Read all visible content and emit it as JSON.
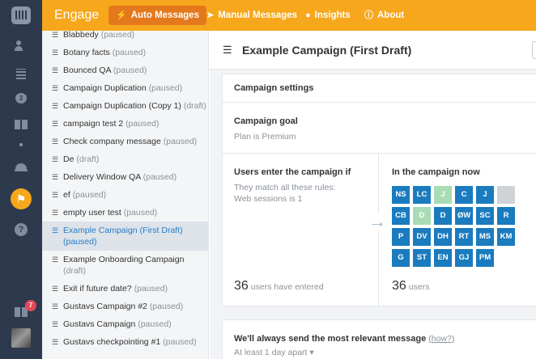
{
  "app": {
    "name": "Engage"
  },
  "nav": [
    {
      "label": "Auto Messages",
      "icon": "lightning-icon",
      "active": true
    },
    {
      "label": "Manual Messages",
      "icon": "paper-plane-icon",
      "active": false
    },
    {
      "label": "Insights",
      "icon": "lightbulb-icon",
      "active": false
    },
    {
      "label": "About",
      "icon": "info-icon",
      "active": false
    }
  ],
  "rail": {
    "notification_badge": "7",
    "chat_count": "3"
  },
  "campaigns": [
    {
      "name": "Blabbedy",
      "status": "(paused)"
    },
    {
      "name": "Botany facts",
      "status": "(paused)"
    },
    {
      "name": "Bounced QA",
      "status": "(paused)"
    },
    {
      "name": "Campaign Duplication",
      "status": "(paused)"
    },
    {
      "name": "Campaign Duplication (Copy 1)",
      "status": "(draft)"
    },
    {
      "name": "campaign test 2",
      "status": "(paused)"
    },
    {
      "name": "Check company message",
      "status": "(paused)"
    },
    {
      "name": "De",
      "status": "(draft)"
    },
    {
      "name": "Delivery Window QA",
      "status": "(paused)"
    },
    {
      "name": "ef",
      "status": "(paused)"
    },
    {
      "name": "empty user test",
      "status": "(paused)"
    },
    {
      "name": "Example Campaign (First Draft)",
      "status": "(paused)",
      "selected": true
    },
    {
      "name": "Example Onboarding Campaign",
      "status": "(draft)"
    },
    {
      "name": "Exit if future date?",
      "status": "(paused)"
    },
    {
      "name": "Gustavs Campaign #2",
      "status": "(paused)"
    },
    {
      "name": "Gustavs Campaign",
      "status": "(paused)"
    },
    {
      "name": "Gustavs checkpointing #1",
      "status": "(paused)"
    }
  ],
  "main": {
    "title": "Example Campaign (First Draft)",
    "settings_header": "Campaign settings",
    "goal_label": "Campaign goal",
    "goal_value": "Plan is Premium",
    "enter_title": "Users enter the campaign if",
    "enter_sub": "They match all these rules:",
    "enter_rule": "Web sessions is 1",
    "entered_count": "36",
    "entered_label": "users have entered",
    "now_title": "In the campaign now",
    "now_count": "36",
    "now_label": "users",
    "users": [
      {
        "initials": "NS",
        "color": "#1a7bbf"
      },
      {
        "initials": "LC",
        "color": "#1a7bbf"
      },
      {
        "initials": "J",
        "color": "#a8dcb4"
      },
      {
        "initials": "C",
        "color": "#1a7bbf"
      },
      {
        "initials": "J",
        "color": "#1a7bbf"
      },
      {
        "initials": "",
        "color": "#cfd3d7"
      },
      {
        "initials": "CB",
        "color": "#1a7bbf"
      },
      {
        "initials": "D",
        "color": "#a8dcb4"
      },
      {
        "initials": "D",
        "color": "#1a7bbf"
      },
      {
        "initials": "ØW",
        "color": "#1a7bbf"
      },
      {
        "initials": "SC",
        "color": "#1a7bbf"
      },
      {
        "initials": "R",
        "color": "#1a7bbf"
      },
      {
        "initials": "P",
        "color": "#1a7bbf"
      },
      {
        "initials": "DV",
        "color": "#1a7bbf"
      },
      {
        "initials": "DH",
        "color": "#1a7bbf"
      },
      {
        "initials": "RT",
        "color": "#1a7bbf"
      },
      {
        "initials": "MS",
        "color": "#1a7bbf"
      },
      {
        "initials": "KM",
        "color": "#1a7bbf"
      },
      {
        "initials": "G",
        "color": "#1a7bbf"
      },
      {
        "initials": "ST",
        "color": "#1a7bbf"
      },
      {
        "initials": "EN",
        "color": "#1a7bbf"
      },
      {
        "initials": "GJ",
        "color": "#1a7bbf"
      },
      {
        "initials": "PM",
        "color": "#1a7bbf"
      },
      {
        "initials": "",
        "color": "#ffffff"
      }
    ],
    "send_title": "We'll always send the most relevant message",
    "send_link": "(how?)",
    "send_sub": "At least 1 day apart ▾"
  }
}
